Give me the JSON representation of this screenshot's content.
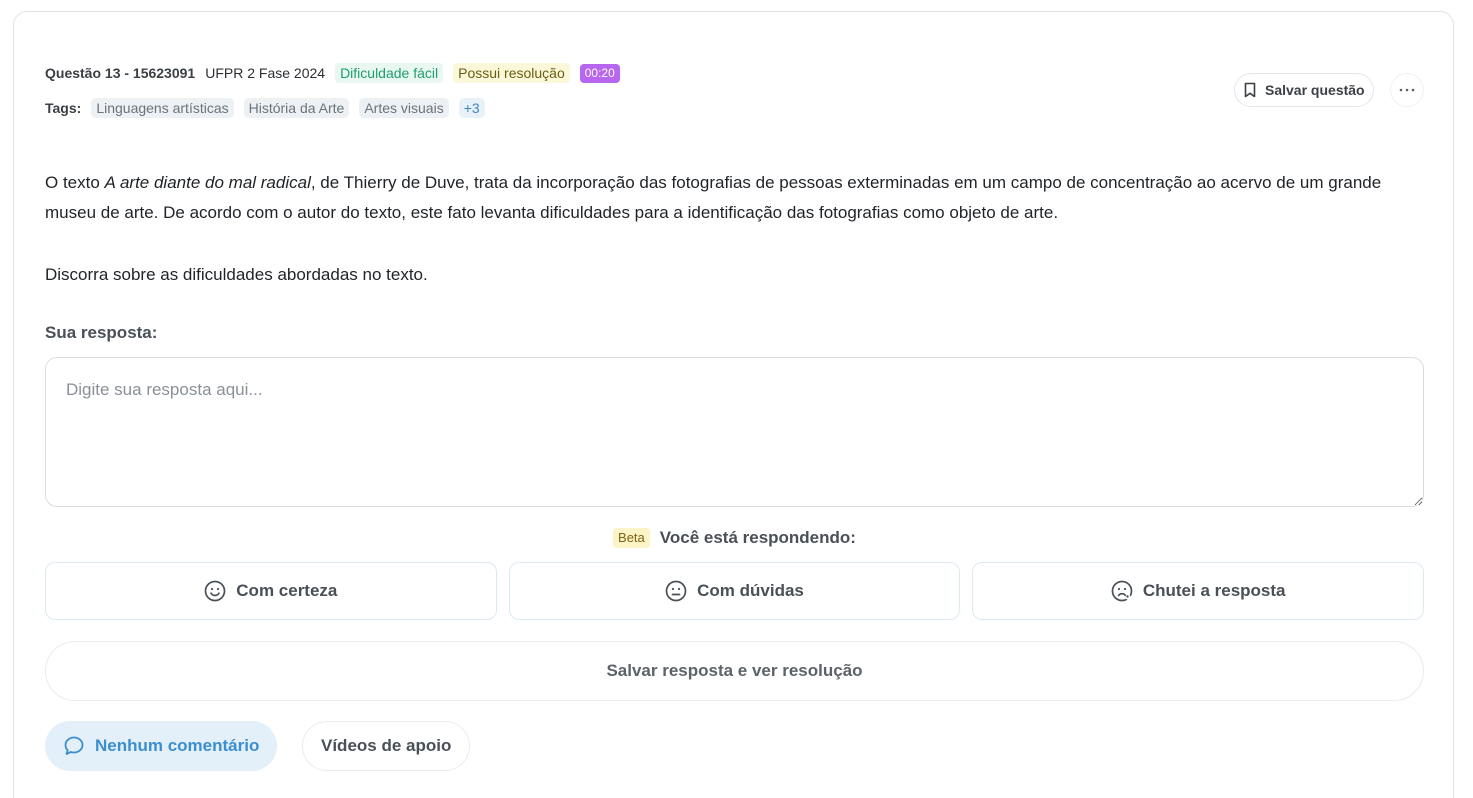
{
  "question": {
    "id_label": "Questão 13 - 15623091",
    "source": "UFPR 2 Fase 2024",
    "difficulty_badge": "Dificuldade fácil",
    "resolution_badge": "Possui resolução",
    "timer": "00:20"
  },
  "tags": {
    "label": "Tags:",
    "items": [
      "Linguagens artísticas",
      "História da Arte",
      "Artes visuais"
    ],
    "more": "+3"
  },
  "actions": {
    "save_question": "Salvar questão",
    "more_icon": "ellipsis-icon"
  },
  "statement": {
    "p1_prefix": "O texto ",
    "p1_italic": "A arte diante do mal radical",
    "p1_suffix": ", de Thierry de Duve, trata da incorporação das fotografias de pessoas exterminadas em um campo de concentração ao acervo de um grande museu de arte. De acordo com o autor do texto, este fato levanta dificuldades para a identificação das fotografias como objeto de arte.",
    "p2": "Discorra sobre as dificuldades abordadas no texto."
  },
  "answer": {
    "label": "Sua resposta:",
    "placeholder": "Digite sua resposta aqui...",
    "value": ""
  },
  "confidence": {
    "beta": "Beta",
    "prompt": "Você está respondendo:",
    "options": [
      {
        "label": "Com certeza",
        "icon": "smile-icon"
      },
      {
        "label": "Com dúvidas",
        "icon": "neutral-face-icon"
      },
      {
        "label": "Chutei a resposta",
        "icon": "unsure-face-icon"
      }
    ]
  },
  "submit": {
    "label": "Salvar resposta e ver resolução"
  },
  "footer": {
    "comments": "Nenhum comentário",
    "videos": "Vídeos de apoio"
  },
  "colors": {
    "accent_blue": "#3b8fd0",
    "difficulty_green": "#1f9d72",
    "timer_purple": "#b866f0",
    "resolution_yellow_bg": "#fbf8d9"
  }
}
